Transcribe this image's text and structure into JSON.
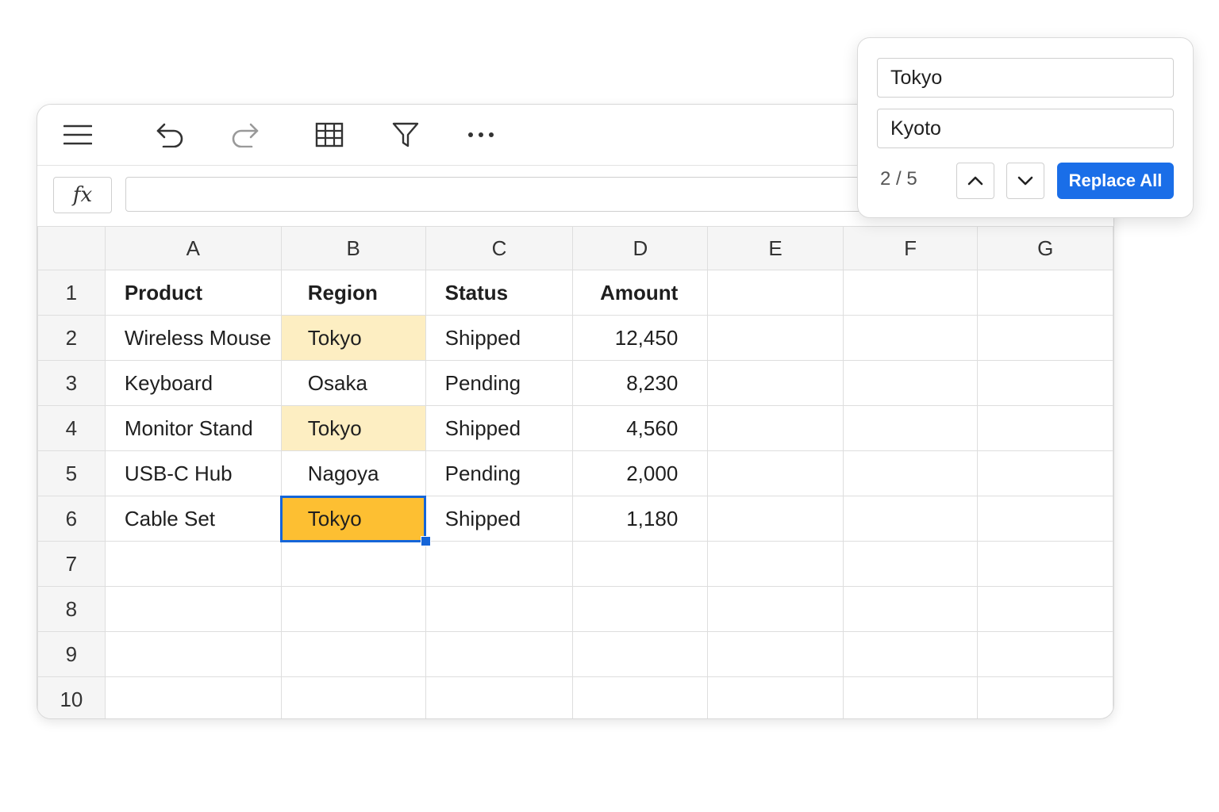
{
  "toolbar": {
    "icons": [
      "menu-icon",
      "undo-icon",
      "redo-icon",
      "table-icon",
      "filter-icon",
      "more-icon"
    ]
  },
  "formula_bar": {
    "fx_label": "fx",
    "value": ""
  },
  "columns": [
    "A",
    "B",
    "C",
    "D",
    "E",
    "F",
    "G"
  ],
  "rows": [
    {
      "num": "1",
      "product": "Product",
      "region": "Region",
      "status": "Status",
      "amount": "Amount"
    },
    {
      "num": "2",
      "product": "Wireless Mouse",
      "region": "Tokyo",
      "status": "Shipped",
      "amount": "12,450"
    },
    {
      "num": "3",
      "product": "Keyboard",
      "region": "Osaka",
      "status": "Pending",
      "amount": "8,230"
    },
    {
      "num": "4",
      "product": "Monitor Stand",
      "region": "Tokyo",
      "status": "Shipped",
      "amount": "4,560"
    },
    {
      "num": "5",
      "product": "USB-C Hub",
      "region": "Nagoya",
      "status": "Pending",
      "amount": "2,000"
    },
    {
      "num": "6",
      "product": "Cable Set",
      "region": "Tokyo",
      "status": "Shipped",
      "amount": "1,180"
    },
    {
      "num": "7"
    },
    {
      "num": "8"
    },
    {
      "num": "9"
    },
    {
      "num": "10"
    }
  ],
  "find_replace": {
    "find_value": "Tokyo",
    "replace_value": "Kyoto",
    "match_count": "2 / 5",
    "replace_all_label": "Replace All"
  },
  "colors": {
    "match_highlight": "#fdeec2",
    "active_match": "#fdbf32",
    "selection_border": "#1565d8",
    "accent": "#1a6ee8"
  }
}
